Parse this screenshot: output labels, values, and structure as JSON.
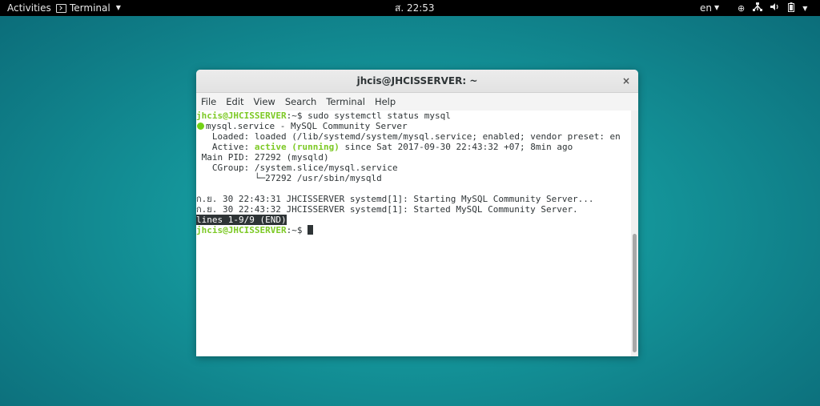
{
  "topbar": {
    "activities": "Activities",
    "app_name": "Terminal",
    "clock": "ส. 22:53",
    "language": "en",
    "tray_icons": [
      "accessibility-icon",
      "network-icon",
      "volume-icon",
      "battery-icon",
      "system-menu-icon"
    ]
  },
  "window": {
    "title": "jhcis@JHCISSERVER: ~",
    "close_label": "×",
    "menu": [
      "File",
      "Edit",
      "View",
      "Search",
      "Terminal",
      "Help"
    ]
  },
  "terminal": {
    "prompt_user": "jhcis@JHCISSERVER",
    "prompt_suffix": ":~$ ",
    "command": "sudo systemctl status mysql",
    "service_line": "mysql.service - MySQL Community Server",
    "loaded_line": "   Loaded: loaded (/lib/systemd/system/mysql.service; enabled; vendor preset: en",
    "active_label": "   Active: ",
    "active_status": "active (running)",
    "active_rest": " since Sat 2017-09-30 22:43:32 +07; 8min ago",
    "mainpid_line": " Main PID: 27292 (mysqld)",
    "cgroup_line": "   CGroup: /system.slice/mysql.service",
    "cgroup_child_line": "           └─27292 /usr/sbin/mysqld",
    "log_line_1": "ก.ย. 30 22:43:31 JHCISSERVER systemd[1]: Starting MySQL Community Server...",
    "log_line_2": "ก.ย. 30 22:43:32 JHCISSERVER systemd[1]: Started MySQL Community Server.",
    "pager_status": "lines 1-9/9 (END)",
    "final_prompt_suffix": ":~$ "
  },
  "colors": {
    "prompt_green": "#7cc924",
    "status_dot": "#73d216",
    "desktop_teal": "#1aa9a8"
  }
}
